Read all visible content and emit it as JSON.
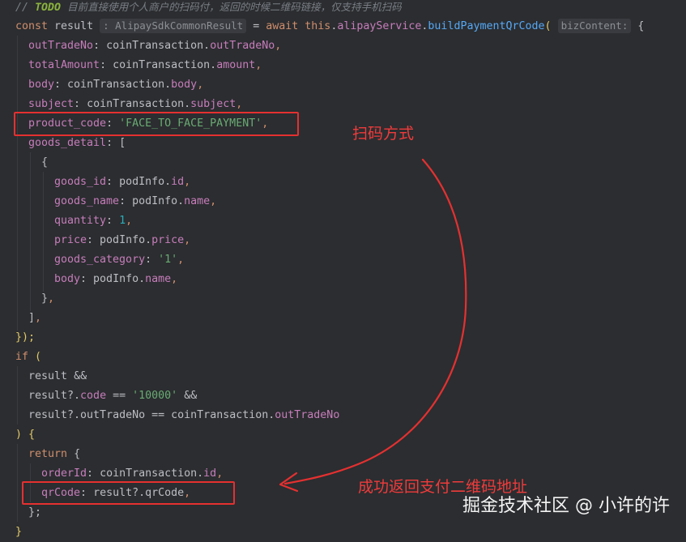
{
  "comment": {
    "prefix": "//",
    "todo": "TODO",
    "text": "目前直接使用个人商户的扫码付，返回的时候二维码链接，仅支持手机扫码"
  },
  "line1": {
    "kw_const": "const",
    "var": "result",
    "type_hint": ": AlipaySdkCommonResult",
    "eq": " =",
    "kw_await": "await",
    "kw_this": "this",
    "service": "alipayService",
    "method": "buildPaymentQrCode",
    "param_hint": "bizContent:",
    "brace_open": "{"
  },
  "fields": [
    {
      "key": "outTradeNo",
      "obj": "coinTransaction",
      "prop": "outTradeNo"
    },
    {
      "key": "totalAmount",
      "obj": "coinTransaction",
      "prop": "amount"
    },
    {
      "key": "body",
      "obj": "coinTransaction",
      "prop": "body"
    },
    {
      "key": "subject",
      "obj": "coinTransaction",
      "prop": "subject"
    }
  ],
  "product_code": {
    "key": "product_code",
    "value": "'FACE_TO_FACE_PAYMENT'"
  },
  "goods_detail": {
    "key": "goods_detail",
    "open": "["
  },
  "goods_item_open": "{",
  "goods_fields": [
    {
      "key": "goods_id",
      "obj": "podInfo",
      "prop": "id"
    },
    {
      "key": "goods_name",
      "obj": "podInfo",
      "prop": "name"
    },
    {
      "key": "quantity",
      "num": "1"
    },
    {
      "key": "price",
      "obj": "podInfo",
      "prop": "price"
    },
    {
      "key": "goods_category",
      "str": "'1'"
    },
    {
      "key": "body",
      "obj": "podInfo",
      "prop": "name"
    }
  ],
  "goods_item_close": "}",
  "goods_detail_close": "]",
  "call_close": "});",
  "if_line": {
    "kw": "if",
    "paren": "("
  },
  "cond1": {
    "id": "result",
    "op": "&&"
  },
  "cond2": {
    "id": "result?.",
    "prop": "code",
    "op": "==",
    "str": "'10000'",
    "op2": "&&"
  },
  "cond3": {
    "id": "result?.outTradeNo",
    "op": "==",
    "obj": "coinTransaction",
    "prop": "outTradeNo"
  },
  "if_close": ") {",
  "return_line": {
    "kw": "return",
    "brace": "{"
  },
  "ret_fields": [
    {
      "key": "orderId",
      "obj": "coinTransaction",
      "prop": "id"
    },
    {
      "key": "qrCode",
      "expr": "result?.qrCode"
    }
  ],
  "ret_close": "};",
  "final_close": "}",
  "annotations": {
    "scan_method": "扫码方式",
    "success_return": "成功返回支付二维码地址"
  },
  "watermark": "掘金技术社区 @ 小许的许",
  "colors": {
    "annotation_red": "#e53030",
    "background": "#2b2d30"
  }
}
